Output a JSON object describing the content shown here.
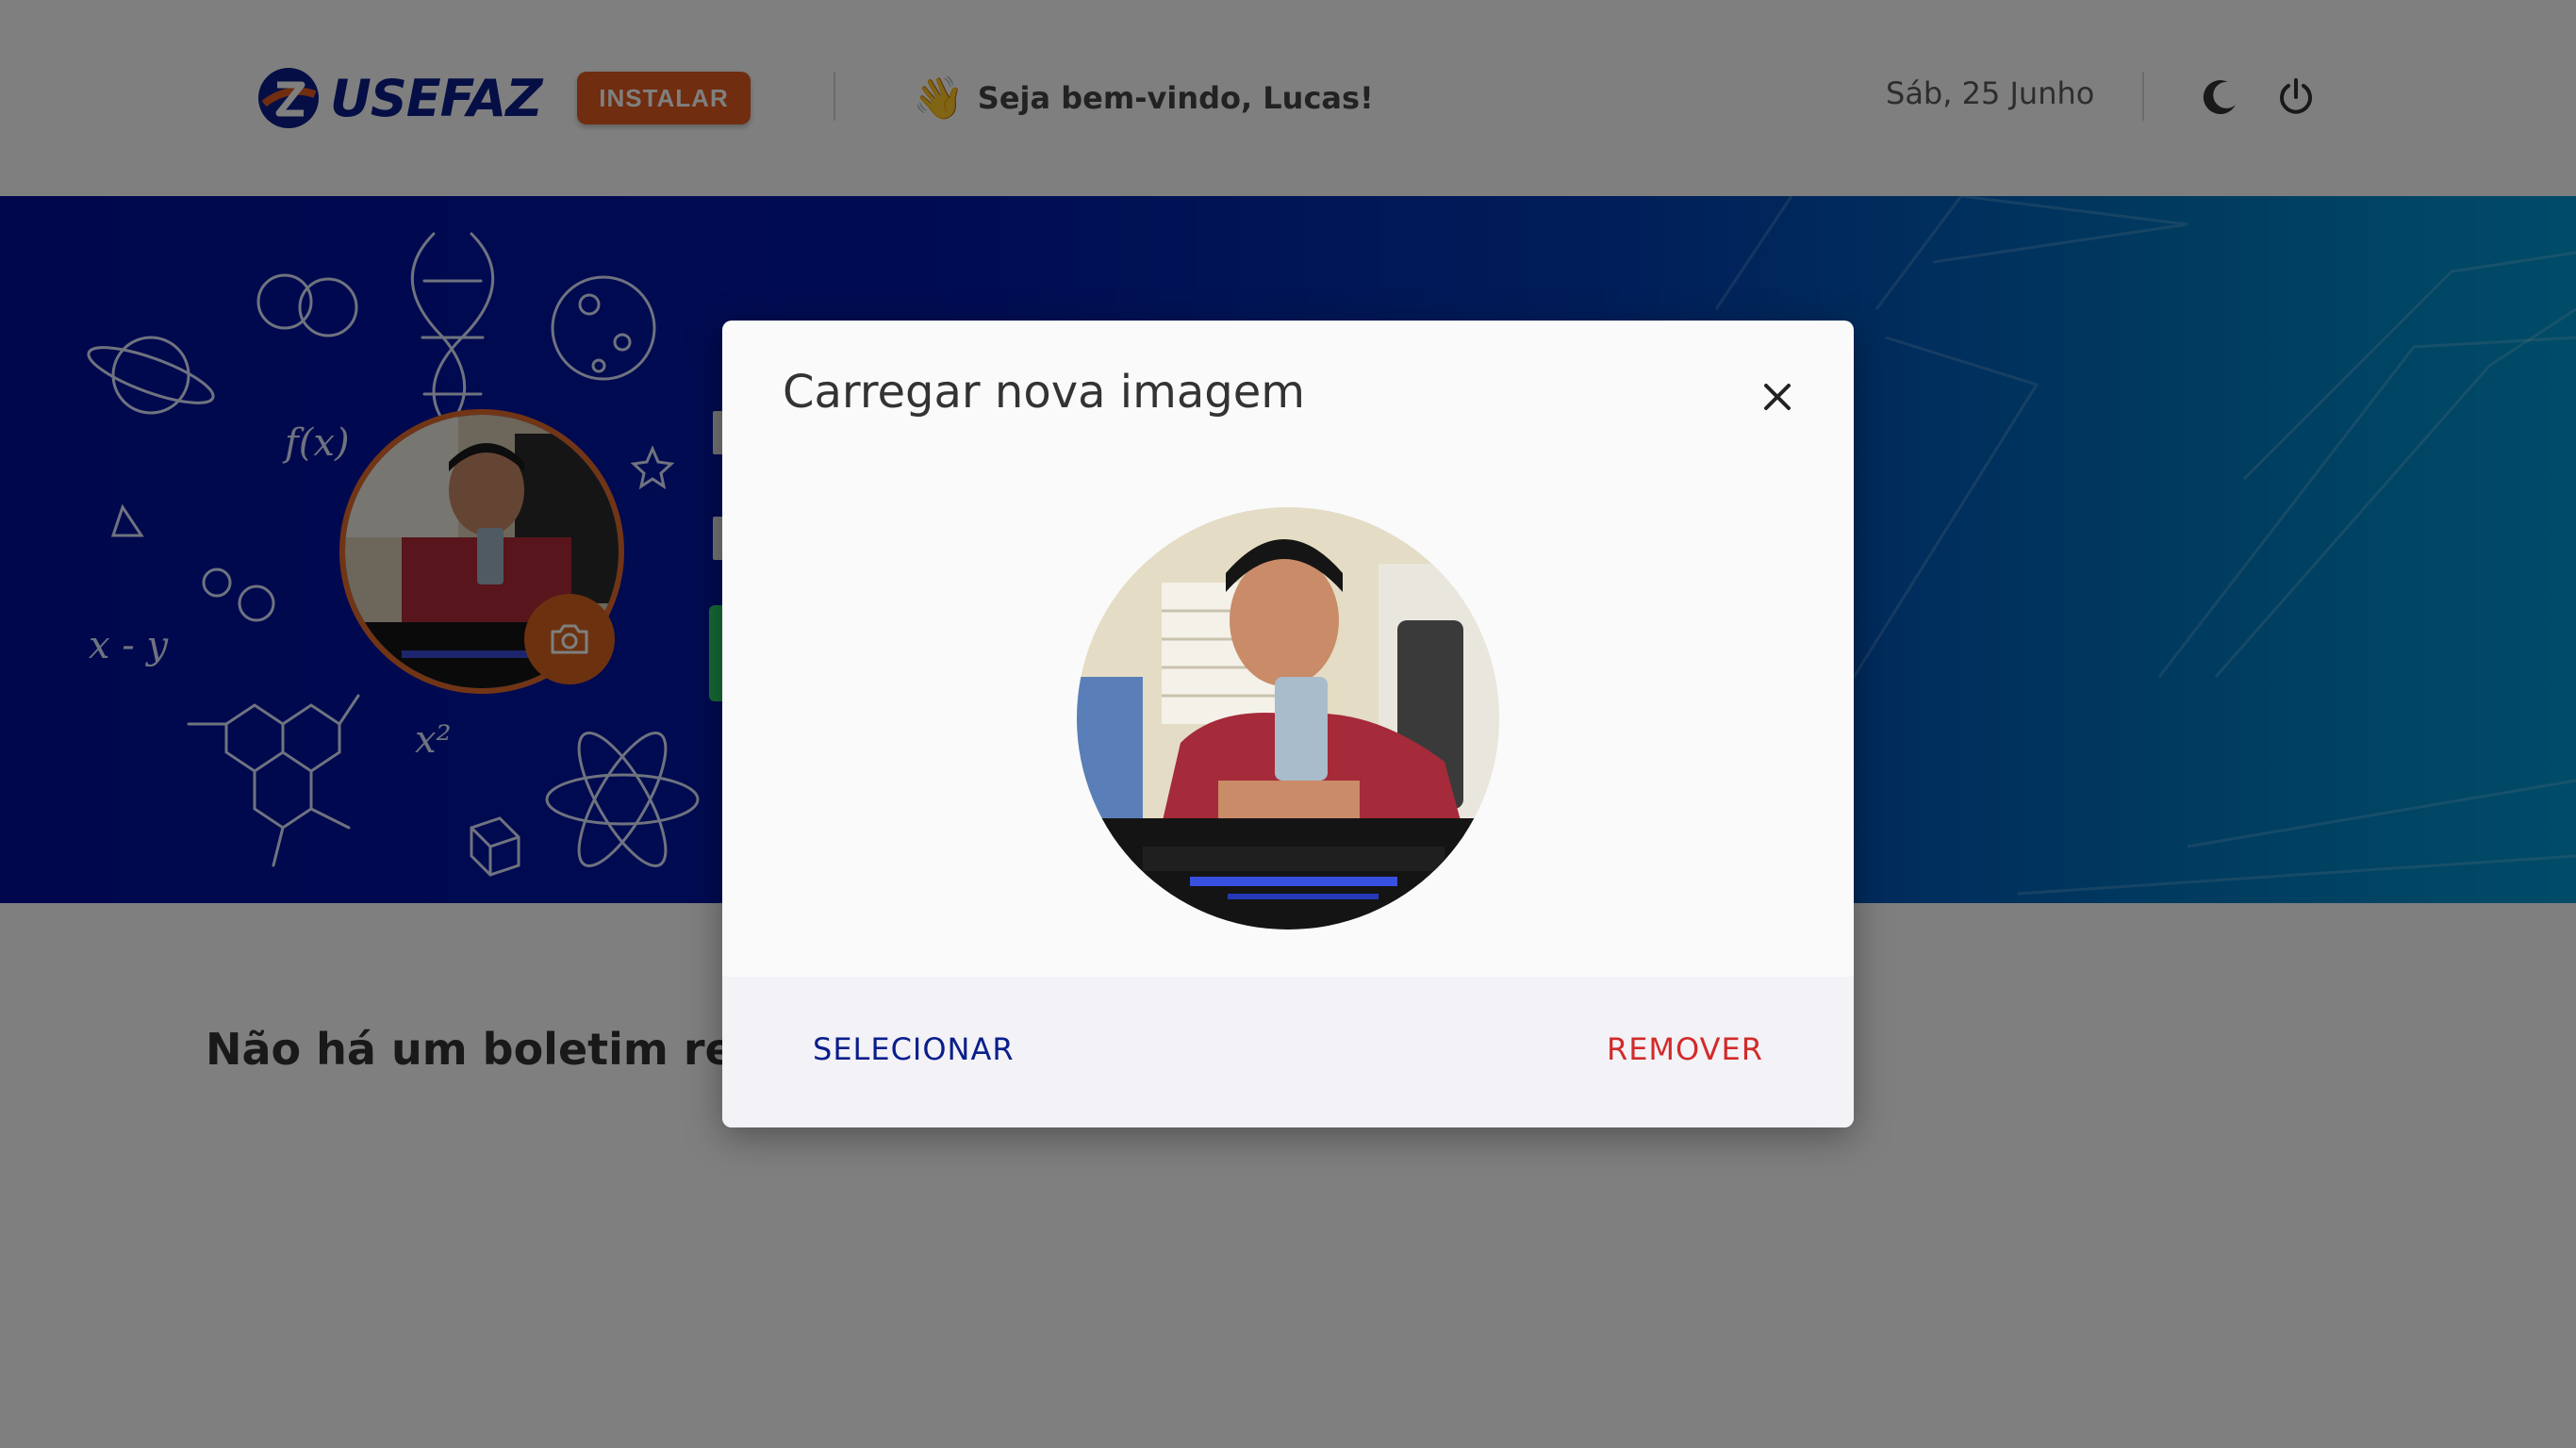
{
  "header": {
    "logo_text": "USEFAZ",
    "install_label": "INSTALAR",
    "welcome_emoji": "👋",
    "welcome_text": "Seja bem-vindo, Lucas!",
    "date": "Sáb, 25 Junho",
    "icons": [
      "moon-icon",
      "power-icon"
    ]
  },
  "banner": {
    "doodle_texts": [
      "f(x)",
      "x - y",
      "x²"
    ],
    "colors": {
      "start": "#000e9a",
      "end": "#0098d0"
    }
  },
  "content": {
    "empty_message": "Não há um boletim reg"
  },
  "modal": {
    "title": "Carregar nova imagem",
    "select_label": "SELECIONAR",
    "remove_label": "REMOVER"
  },
  "colors": {
    "brand_blue": "#0a1e8a",
    "accent_orange": "#e05a1e",
    "danger_red": "#d22a2a"
  }
}
